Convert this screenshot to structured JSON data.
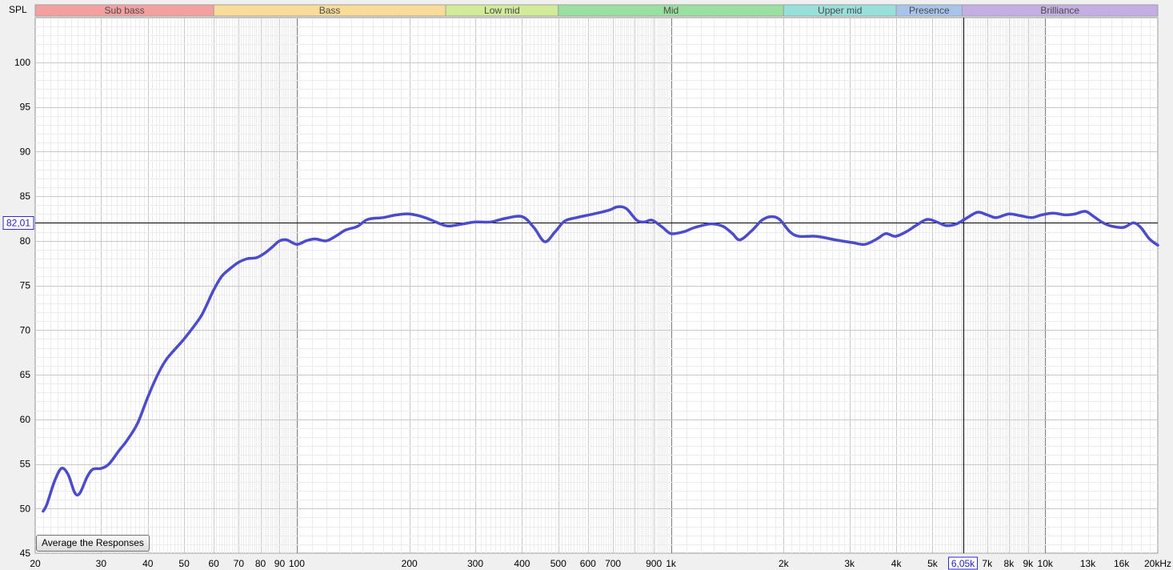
{
  "chart_data": {
    "type": "line",
    "ylabel": "SPL",
    "xunit": "kHz",
    "xlim": [
      20,
      20000
    ],
    "ylim": [
      45,
      105
    ],
    "xscale": "log",
    "grid": true,
    "y_ticks": [
      45,
      50,
      55,
      60,
      65,
      70,
      75,
      80,
      85,
      90,
      95,
      100
    ],
    "x_ticks": [
      {
        "v": 20,
        "label": "20"
      },
      {
        "v": 30,
        "label": "30"
      },
      {
        "v": 40,
        "label": "40"
      },
      {
        "v": 50,
        "label": "50"
      },
      {
        "v": 60,
        "label": "60"
      },
      {
        "v": 70,
        "label": "70"
      },
      {
        "v": 80,
        "label": "80"
      },
      {
        "v": 90,
        "label": "90"
      },
      {
        "v": 100,
        "label": "100"
      },
      {
        "v": 200,
        "label": "200"
      },
      {
        "v": 300,
        "label": "300"
      },
      {
        "v": 400,
        "label": "400"
      },
      {
        "v": 500,
        "label": "500"
      },
      {
        "v": 600,
        "label": "600"
      },
      {
        "v": 700,
        "label": "700"
      },
      {
        "v": 900,
        "label": "900"
      },
      {
        "v": 1000,
        "label": "1k"
      },
      {
        "v": 2000,
        "label": "2k"
      },
      {
        "v": 3000,
        "label": "3k"
      },
      {
        "v": 4000,
        "label": "4k"
      },
      {
        "v": 5000,
        "label": "5k"
      },
      {
        "v": 7000,
        "label": "7k"
      },
      {
        "v": 8000,
        "label": "8k"
      },
      {
        "v": 9000,
        "label": "9k"
      },
      {
        "v": 10000,
        "label": "10k"
      },
      {
        "v": 13000,
        "label": "13k",
        "faded": true
      },
      {
        "v": 16000,
        "label": "16k",
        "faded": true
      },
      {
        "v": 20000,
        "label": "20kHz"
      }
    ],
    "bands": [
      {
        "name": "Sub bass",
        "from": 20,
        "to": 60,
        "color": "#f4a0a0"
      },
      {
        "name": "Bass",
        "from": 60,
        "to": 250,
        "color": "#f8dc98"
      },
      {
        "name": "Low mid",
        "from": 250,
        "to": 500,
        "color": "#d2eb98"
      },
      {
        "name": "Mid",
        "from": 500,
        "to": 2000,
        "color": "#9ae0a0"
      },
      {
        "name": "Upper mid",
        "from": 2000,
        "to": 4000,
        "color": "#98e0dc"
      },
      {
        "name": "Presence",
        "from": 4000,
        "to": 6000,
        "color": "#a8c4ec"
      },
      {
        "name": "Brilliance",
        "from": 6000,
        "to": 20000,
        "color": "#c4aee4"
      }
    ],
    "cursor": {
      "x": 6050,
      "y": 82.01,
      "x_label": "6,05k",
      "y_label": "82,01"
    },
    "series": [
      {
        "color": "#4b4bcc",
        "points": [
          [
            21,
            49.7
          ],
          [
            21.5,
            50.5
          ],
          [
            22.5,
            53
          ],
          [
            23.5,
            54.5
          ],
          [
            24.5,
            53.8
          ],
          [
            25.5,
            51.8
          ],
          [
            26.3,
            51.7
          ],
          [
            27.5,
            53.5
          ],
          [
            28.5,
            54.4
          ],
          [
            30,
            54.5
          ],
          [
            31.5,
            55
          ],
          [
            33.5,
            56.5
          ],
          [
            35,
            57.5
          ],
          [
            37.5,
            59.5
          ],
          [
            40,
            62.5
          ],
          [
            42.5,
            65
          ],
          [
            45,
            66.8
          ],
          [
            50,
            69
          ],
          [
            55,
            71.3
          ],
          [
            57,
            72.5
          ],
          [
            60,
            74.5
          ],
          [
            63,
            76
          ],
          [
            66,
            76.8
          ],
          [
            70,
            77.6
          ],
          [
            74,
            78
          ],
          [
            78,
            78.1
          ],
          [
            82,
            78.6
          ],
          [
            86,
            79.3
          ],
          [
            90,
            80
          ],
          [
            94,
            80.1
          ],
          [
            100,
            79.6
          ],
          [
            106,
            80
          ],
          [
            112,
            80.2
          ],
          [
            120,
            80
          ],
          [
            128,
            80.6
          ],
          [
            135,
            81.2
          ],
          [
            145,
            81.6
          ],
          [
            155,
            82.4
          ],
          [
            170,
            82.6
          ],
          [
            185,
            82.9
          ],
          [
            200,
            83
          ],
          [
            220,
            82.6
          ],
          [
            250,
            81.7
          ],
          [
            270,
            81.8
          ],
          [
            300,
            82.1
          ],
          [
            330,
            82.1
          ],
          [
            360,
            82.5
          ],
          [
            400,
            82.7
          ],
          [
            430,
            81.5
          ],
          [
            460,
            79.9
          ],
          [
            490,
            81
          ],
          [
            520,
            82.2
          ],
          [
            560,
            82.6
          ],
          [
            620,
            83
          ],
          [
            680,
            83.4
          ],
          [
            720,
            83.8
          ],
          [
            760,
            83.6
          ],
          [
            810,
            82.3
          ],
          [
            850,
            82.1
          ],
          [
            890,
            82.3
          ],
          [
            950,
            81.5
          ],
          [
            1000,
            80.8
          ],
          [
            1080,
            81
          ],
          [
            1160,
            81.5
          ],
          [
            1280,
            81.9
          ],
          [
            1380,
            81.6
          ],
          [
            1460,
            80.8
          ],
          [
            1530,
            80.1
          ],
          [
            1650,
            81.2
          ],
          [
            1750,
            82.3
          ],
          [
            1850,
            82.7
          ],
          [
            1950,
            82.4
          ],
          [
            2080,
            81
          ],
          [
            2200,
            80.5
          ],
          [
            2450,
            80.5
          ],
          [
            2750,
            80.1
          ],
          [
            3050,
            79.8
          ],
          [
            3300,
            79.6
          ],
          [
            3550,
            80.2
          ],
          [
            3750,
            80.8
          ],
          [
            3980,
            80.5
          ],
          [
            4250,
            81
          ],
          [
            4550,
            81.8
          ],
          [
            4850,
            82.4
          ],
          [
            5200,
            82
          ],
          [
            5450,
            81.7
          ],
          [
            5800,
            81.9
          ],
          [
            6200,
            82.6
          ],
          [
            6600,
            83.2
          ],
          [
            7000,
            82.9
          ],
          [
            7400,
            82.6
          ],
          [
            8000,
            83
          ],
          [
            8600,
            82.8
          ],
          [
            9200,
            82.6
          ],
          [
            9800,
            82.9
          ],
          [
            10500,
            83.1
          ],
          [
            11300,
            82.9
          ],
          [
            12000,
            83
          ],
          [
            12800,
            83.3
          ],
          [
            13500,
            82.7
          ],
          [
            14300,
            82
          ],
          [
            15200,
            81.6
          ],
          [
            16200,
            81.5
          ],
          [
            17200,
            82
          ],
          [
            18000,
            81.5
          ],
          [
            19000,
            80.2
          ],
          [
            20000,
            79.5
          ]
        ]
      }
    ]
  },
  "button": {
    "label": "Average the Responses"
  }
}
